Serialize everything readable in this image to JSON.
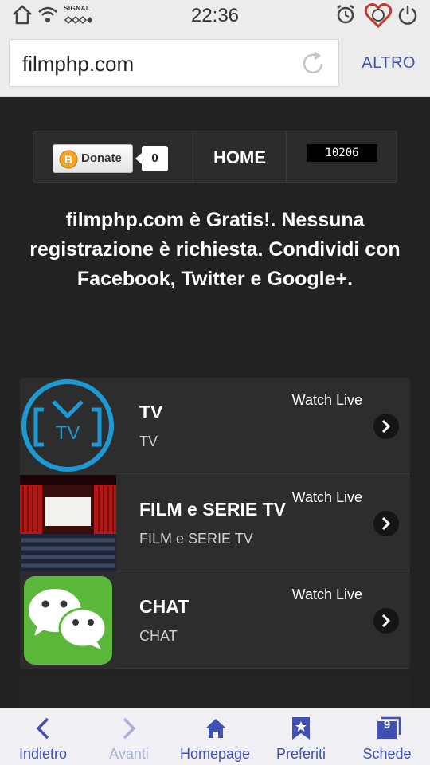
{
  "status_bar": {
    "time": "22:36",
    "signal_label": "SIGNAL",
    "icons": [
      "home-icon",
      "wifi-icon",
      "signal-icon",
      "alarm-icon",
      "heart-icon",
      "power-icon"
    ]
  },
  "browser": {
    "url": "filmphp.com",
    "menu_label": "ALTRO",
    "accent_color": "#3f51b5"
  },
  "topnav": {
    "donate_label": "Donate",
    "donate_count": "0",
    "home_label": "HOME",
    "visit_counter": "10206"
  },
  "headline": "filmphp.com è Gratis!. Nessuna registrazione è richiesta. Condividi con Facebook, Twitter e Google+.",
  "channels": [
    {
      "title": "TV",
      "subtitle": "TV",
      "watch_label": "Watch Live",
      "thumb_icon": "tv-logo-icon"
    },
    {
      "title": "FILM e SERIE TV",
      "subtitle": "FILM e SERIE TV",
      "watch_label": "Watch Live",
      "thumb_icon": "cinema-thumbnail"
    },
    {
      "title": "CHAT",
      "subtitle": "CHAT",
      "watch_label": "Watch Live",
      "thumb_icon": "chat-bubbles-icon"
    }
  ],
  "toolbar": {
    "back_label": "Indietro",
    "forward_label": "Avanti",
    "home_label": "Homepage",
    "bookmarks_label": "Preferiti",
    "tabs_label": "Schede",
    "tabs_count": "9"
  }
}
